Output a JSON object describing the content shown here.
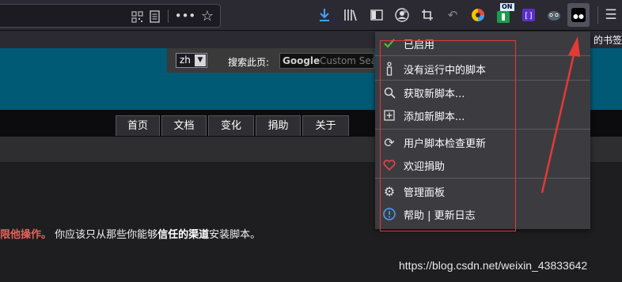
{
  "toolbar": {
    "icons": [
      "qr-code-icon",
      "reader-view-icon",
      "more-options-icon",
      "bookmark-star-icon",
      "download-icon",
      "library-icon",
      "sidebar-icon",
      "account-icon",
      "crop-icon",
      "undo-icon",
      "color-wheel-icon",
      "extension-on-icon",
      "extension-bracket-icon",
      "alien-icon",
      "tampermonkey-icon",
      "hamburger-menu-icon"
    ],
    "extension_badge": "ON"
  },
  "bookmarks": {
    "label": "的书签"
  },
  "page": {
    "lang_value": "zh",
    "search_label": "搜索此页:",
    "google_logo": "Google",
    "google_placeholder": "Custom Search",
    "nav_tabs": [
      "首页",
      "文档",
      "变化",
      "捐助",
      "关于"
    ],
    "warning": {
      "part1": "限他操作。",
      "part2": " 你应该只从那些你能够",
      "part3": "信任的渠道",
      "part4": "安装脚本。"
    }
  },
  "menu": {
    "items": [
      {
        "label": "已启用",
        "icon": "checkmark-icon"
      },
      {
        "label": "没有运行中的脚本",
        "icon": "info-icon"
      },
      {
        "label": "获取新脚本...",
        "icon": "search-icon"
      },
      {
        "label": "添加新脚本...",
        "icon": "add-square-icon"
      },
      {
        "label": "用户脚本检查更新",
        "icon": "refresh-icon"
      },
      {
        "label": "欢迎捐助",
        "icon": "heart-icon"
      },
      {
        "label": "管理面板",
        "icon": "settings-gear-icon"
      },
      {
        "label": "帮助 | 更新日志",
        "icon": "help-circle-icon"
      }
    ]
  },
  "watermark": "https://blog.csdn.net/weixin_43833642",
  "colors": {
    "highlight": "#e53935",
    "check": "#57bd35",
    "heart": "#e0474c",
    "help": "#45a1ff"
  }
}
